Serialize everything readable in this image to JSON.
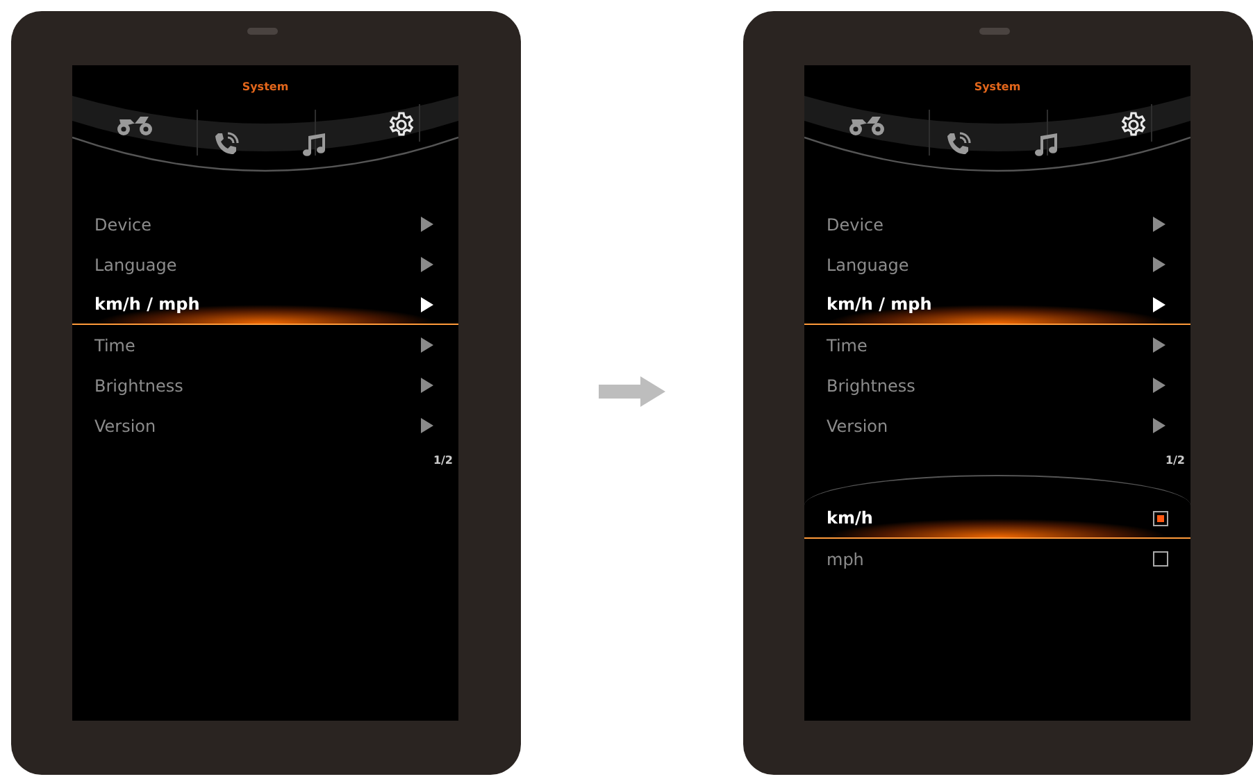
{
  "screens": [
    {
      "title": "System",
      "tabs": [
        {
          "kind": "motorbike",
          "selected": false
        },
        {
          "kind": "phone",
          "selected": false
        },
        {
          "kind": "music",
          "selected": false
        },
        {
          "kind": "gear",
          "selected": true
        }
      ],
      "menu": [
        {
          "label": "Device",
          "selected": false
        },
        {
          "label": "Language",
          "selected": false
        },
        {
          "label": "km/h / mph",
          "selected": true
        },
        {
          "label": "Time",
          "selected": false
        },
        {
          "label": "Brightness",
          "selected": false
        },
        {
          "label": "Version",
          "selected": false
        }
      ],
      "page": "1/2"
    },
    {
      "title": "System",
      "tabs": [
        {
          "kind": "motorbike",
          "selected": false
        },
        {
          "kind": "phone",
          "selected": false
        },
        {
          "kind": "music",
          "selected": false
        },
        {
          "kind": "gear",
          "selected": true
        }
      ],
      "menu": [
        {
          "label": "Device",
          "selected": false
        },
        {
          "label": "Language",
          "selected": false
        },
        {
          "label": "km/h / mph",
          "selected": true
        },
        {
          "label": "Time",
          "selected": false
        },
        {
          "label": "Brightness",
          "selected": false
        },
        {
          "label": "Version",
          "selected": false
        }
      ],
      "page": "1/2",
      "options": [
        {
          "label": "km/h",
          "selected": true,
          "checked": true
        },
        {
          "label": "mph",
          "selected": false,
          "checked": false
        }
      ]
    }
  ]
}
